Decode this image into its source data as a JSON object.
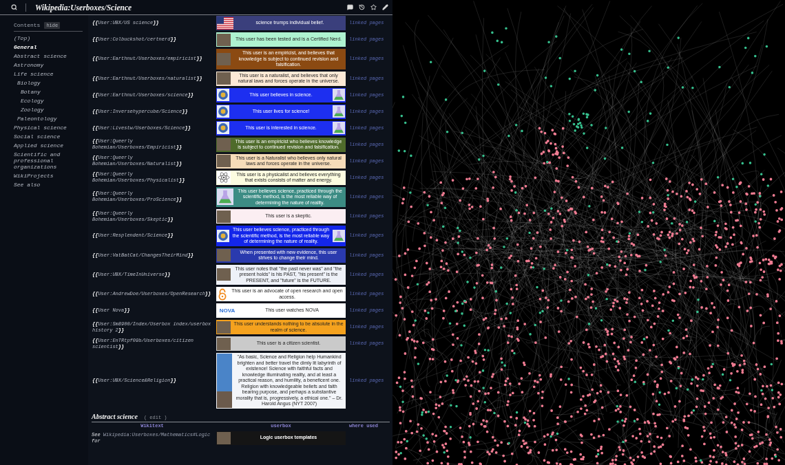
{
  "header": {
    "title": "Wikipedia:Userboxes/Science"
  },
  "toc": {
    "title": "Contents",
    "toggle": "hide",
    "items": [
      {
        "label": "(Top)",
        "selected": false
      },
      {
        "label": "General",
        "selected": true
      },
      {
        "label": "Abstract science",
        "selected": false
      },
      {
        "label": "Astronomy",
        "selected": false
      },
      {
        "label": "Life science",
        "selected": false,
        "children": [
          {
            "label": "Biology",
            "selected": false,
            "children": [
              {
                "label": "Botany",
                "selected": false
              },
              {
                "label": "Ecology",
                "selected": false
              },
              {
                "label": "Zoology",
                "selected": false
              }
            ]
          },
          {
            "label": "Paleontology",
            "selected": false
          }
        ]
      },
      {
        "label": "Physical science",
        "selected": false
      },
      {
        "label": "Social science",
        "selected": false
      },
      {
        "label": "Applied science",
        "selected": false
      },
      {
        "label": "Scientific and professional organizations",
        "selected": false
      },
      {
        "label": "WikiProjects",
        "selected": false
      },
      {
        "label": "See also",
        "selected": false
      }
    ]
  },
  "table": {
    "rows": [
      {
        "template": "**{{**User:UBX/US science**}}**",
        "userbox": {
          "kind": "flag",
          "color": "#3a3f7c",
          "text": "science trumps individual belief."
        },
        "usage": "linked pages"
      },
      {
        "template": "**{{**User:Colbuckshot/certnerd**}}**",
        "userbox": {
          "kind": "photo",
          "color": "#aef3d0",
          "text": "This user has been tested and is a Certified Nerd."
        },
        "usage": "linked pages"
      },
      {
        "template": "**{{**User:Earthnut/Userboxes/empiricist**}}**",
        "userbox": {
          "kind": "photo",
          "color": "#8b4a12",
          "text": "This user is an empiricist, and believes that knowledge is subject to continued revision and falsification."
        },
        "usage": "linked pages"
      },
      {
        "template": "**{{**User:Earthnut/Userboxes/naturalist**}}**",
        "userbox": {
          "kind": "photo",
          "color": "#fce9d6",
          "text": "This user is a naturalist, and believes that only natural laws and forces operate in the universe."
        },
        "usage": "linked pages"
      },
      {
        "template": "**{{**User:Earthnut/Userboxes/science**}}**",
        "userbox": {
          "kind": "emblem",
          "color": "#1d2ff0",
          "text": "This user believes in science."
        },
        "usage": "linked pages"
      },
      {
        "template": "**{{**User:Inversehypercube/Science**}}**",
        "userbox": {
          "kind": "emblem",
          "color": "#1d2ff0",
          "text": "This user lives for science!"
        },
        "usage": "linked pages"
      },
      {
        "template": "**{{**User:Livestw/Userboxes/Science**}}**",
        "userbox": {
          "kind": "emblem",
          "color": "#1d2ff0",
          "text": "This user is interested in science."
        },
        "usage": "linked pages"
      },
      {
        "template": "**{{**User:Queerly Bohemian/Userboxes/Empiricist**}}**",
        "userbox": {
          "kind": "photo",
          "color": "#4f6b2b",
          "text": "This user is an empiricist who believes knowledge is subject to continued revision and falsification."
        },
        "usage": "linked pages"
      },
      {
        "template": "**{{**User:Queerly Bohemian/Userboxes/Naturalist**}}**",
        "userbox": {
          "kind": "photo",
          "color": "#f6dcb9",
          "text": "This user is a Naturalist who believes only natural laws and forces operate in the universe."
        },
        "usage": "linked pages"
      },
      {
        "template": "**{{**User:Queerly Bohemian/Userboxes/Physicalist**}}**",
        "userbox": {
          "kind": "atom",
          "color": "#fcfce0",
          "text": "This user is a physicalist and believes everything that exists consists of matter and energy."
        },
        "usage": "linked pages"
      },
      {
        "template": "**{{**User:Queerly Bohemian/Userboxes/ProScience**}}**",
        "userbox": {
          "kind": "flask",
          "color": "#3c8c84",
          "text": "This user believes science, practiced through the scientific method, is the most reliable way of determining the nature of reality."
        },
        "usage": "linked pages"
      },
      {
        "template": "**{{**User:Queerly Bohemian/Userboxes/Skeptic**}}**",
        "userbox": {
          "kind": "photo",
          "color": "#fbeef2",
          "text": "This user is a skeptic."
        },
        "usage": "linked pages"
      },
      {
        "template": "**{{**User:Resplendent/Science**}}**",
        "userbox": {
          "kind": "emblem",
          "color": "#1326ea",
          "text": "This user believes science, practiced through the scientific method, is the most reliable way of determining the nature of reality."
        },
        "usage": "linked pages"
      },
      {
        "template": "**{{**User:VatBatCat/ChangesTheirMind**}}**",
        "userbox": {
          "kind": "photo",
          "color": "#2a3aae",
          "text": "When presented with new evidence, this user strives to change their mind."
        },
        "usage": "linked pages"
      },
      {
        "template": "**{{**User:UBX/TimeInUniverse**}}**",
        "userbox": {
          "kind": "photo",
          "color": "#eef1f8",
          "text": "This user notes that \"the past never was\" and \"the present holds\" is his PAST, \"his present\" is the PRESENT, and \"future\" is the FUTURE."
        },
        "usage": "linked pages"
      },
      {
        "template": "**{{**User:AndrewDoe/Userboxes/OpenResearch**}}**",
        "userbox": {
          "kind": "lock",
          "color": "#ffffff",
          "text": "This user is an advocate of open research and open access."
        },
        "usage": "linked pages"
      },
      {
        "template": "**{{**User Nova**}}**",
        "userbox": {
          "kind": "logo",
          "color": "#ffffff",
          "logo": "NOVA",
          "text": "This user watches NOVA"
        },
        "usage": "linked pages"
      },
      {
        "template": "**{{**User:Sm8900/Index/Userbox index/userbox history 2**}}**",
        "userbox": {
          "kind": "photo",
          "color": "#f5a21e",
          "text": "This user understands nothing to be absolute in the realm of science."
        },
        "usage": "linked pages"
      },
      {
        "template": "**{{**User:EnTRtpf09b/Userboxes/citizen scientist**}}**",
        "userbox": {
          "kind": "photo",
          "color": "#cacaca",
          "text": "This user is a citizen scientist."
        },
        "usage": "linked pages"
      },
      {
        "template": "**{{**User:UBX/Science&Religion**}}**",
        "userbox": {
          "kind": "portrait",
          "color": "#f3f5f9",
          "text": "\"As basic, Science and Religion help Humankind brighten and better travel the dimly lit labyrinth of existence! Science with faithful facts and knowledge illuminating reality, and at least a practical reason, and humility, a beneficent one. Religion with knowledgeable beliefs and faith bearing purpose, and perhaps a substantive morality that is, progressively, a ethical one.\" – Dr. Harold Angus (NYT 2007)"
        },
        "usage": "linked pages"
      }
    ]
  },
  "section": {
    "title": "Abstract science",
    "edit": "( edit )",
    "columns": [
      "Wikitext",
      "userbox",
      "where used"
    ],
    "rows": [
      {
        "text_before": "See",
        "link": "Wikipedia:Userboxes/Mathematics#Logic",
        "text_after": "for",
        "userbox": {
          "kind": "photo",
          "color": "#151515",
          "text": "Logic userbox templates"
        }
      }
    ]
  }
}
